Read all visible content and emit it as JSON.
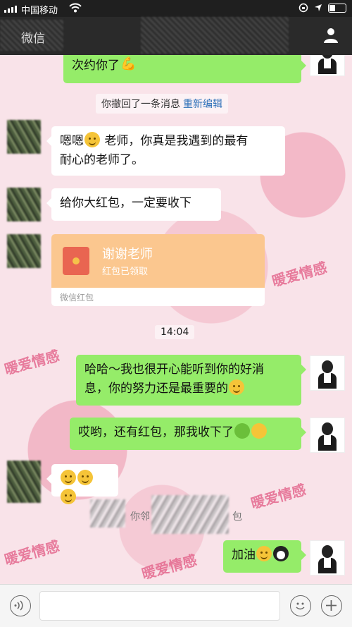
{
  "status_bar": {
    "carrier": "中国移动",
    "icons": [
      "signal-icon",
      "wifi-icon",
      "rotation-lock-icon",
      "location-icon",
      "battery-icon"
    ]
  },
  "nav": {
    "title": "微信",
    "right_icon": "person-icon"
  },
  "messages": {
    "m1": "次约你了",
    "system_recall": "你撤回了一条消息",
    "system_reedit": "重新编辑",
    "m2_a": "嗯嗯",
    "m2_b": "老师，你真是我遇到的最有",
    "m2_c": "耐心的老师了。",
    "m3": "给你大红包，一定要收下",
    "redpacket_title": "谢谢老师",
    "redpacket_status": "红包已领取",
    "redpacket_footer": "微信红包",
    "time": "14:04",
    "m4_a": "哈哈～我也很开心能听到你的好消",
    "m4_b": "息，你的努力还是最重要的",
    "m5": "哎哟，还有红包，那我收下了",
    "m7_partial_a": "你邻",
    "m7_partial_b": "包",
    "m8": "加油"
  },
  "watermark": "暖爱情感",
  "input_bar": {
    "voice_icon": "voice-icon",
    "emoji_icon": "emoji-icon",
    "plus_icon": "plus-icon"
  }
}
